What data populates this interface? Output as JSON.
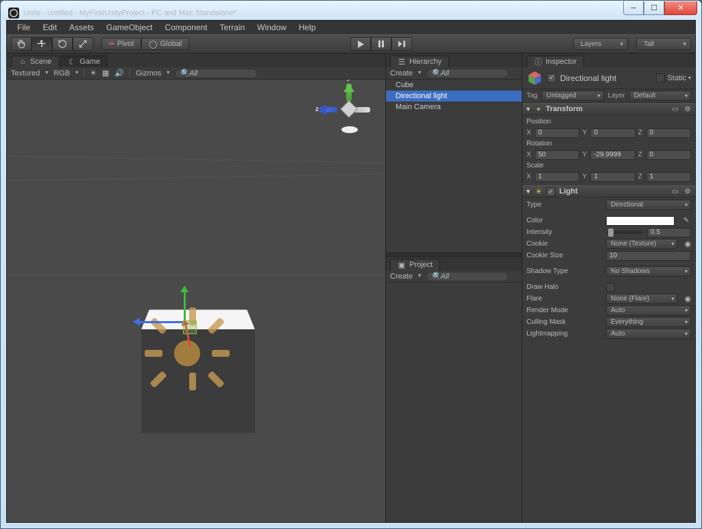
{
  "window": {
    "title": "Unity - Untitled - MyFirstUnityProject - PC and Mac Standalone*"
  },
  "menu": [
    "File",
    "Edit",
    "Assets",
    "GameObject",
    "Component",
    "Terrain",
    "Window",
    "Help"
  ],
  "toolbar": {
    "pivot": "Pivot",
    "global": "Global",
    "layers": "Layers",
    "layout": "Tall"
  },
  "scene": {
    "tab_scene": "Scene",
    "tab_game": "Game",
    "shading": "Textured",
    "render": "RGB",
    "gizmos": "Gizmos",
    "search_placeholder": "All",
    "axis_y": "y",
    "axis_z": "z"
  },
  "hierarchy": {
    "title": "Hierarchy",
    "create": "Create",
    "search_placeholder": "All",
    "items": [
      "Cube",
      "Directional light",
      "Main Camera"
    ],
    "selected_index": 1
  },
  "project": {
    "title": "Project",
    "create": "Create",
    "search_placeholder": "All"
  },
  "inspector": {
    "title": "Inspector",
    "object_name": "Directional light",
    "static_label": "Static",
    "tag_label": "Tag",
    "tag_value": "Untagged",
    "layer_label": "Layer",
    "layer_value": "Default",
    "transform": {
      "title": "Transform",
      "position_label": "Position",
      "rotation_label": "Rotation",
      "scale_label": "Scale",
      "pos": {
        "x": "0",
        "y": "0",
        "z": "0"
      },
      "rot": {
        "x": "50",
        "y": "-29.9999",
        "z": "0"
      },
      "scale": {
        "x": "1",
        "y": "1",
        "z": "1"
      }
    },
    "light": {
      "title": "Light",
      "type_label": "Type",
      "type": "Directional",
      "color_label": "Color",
      "intensity_label": "Intensity",
      "intensity": "0.5",
      "slider_pct": 5,
      "cookie_label": "Cookie",
      "cookie": "None (Texture)",
      "cookiesize_label": "Cookie Size",
      "cookiesize": "10",
      "shadowtype_label": "Shadow Type",
      "shadowtype": "No Shadows",
      "drawhalo_label": "Draw Halo",
      "flare_label": "Flare",
      "flare": "None (Flare)",
      "rendermode_label": "Render Mode",
      "rendermode": "Auto",
      "culling_label": "Culling Mask",
      "culling": "Everything",
      "lightmap_label": "Lightmapping",
      "lightmap": "Auto"
    }
  }
}
